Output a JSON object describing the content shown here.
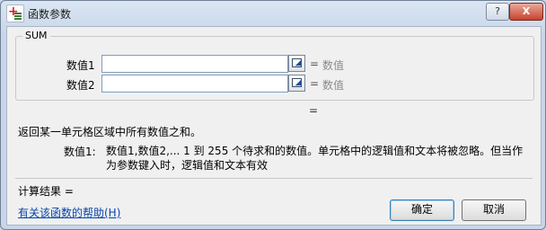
{
  "window": {
    "title": "函数参数",
    "help_glyph": "?",
    "close_glyph": "X"
  },
  "function_group": {
    "name": "SUM",
    "args": [
      {
        "label": "数值1",
        "value": "",
        "result_eq": "=",
        "result": "数值"
      },
      {
        "label": "数值2",
        "value": "",
        "result_eq": "=",
        "result": "数值"
      }
    ],
    "overall_eq": "="
  },
  "description": "返回某一单元格区域中所有数值之和。",
  "param_help": {
    "name": "数值1:",
    "text": "数值1,数值2,... 1 到 255 个待求和的数值。单元格中的逻辑值和文本将被忽略。但当作为参数键入时，逻辑值和文本有效"
  },
  "result": {
    "label": "计算结果 ="
  },
  "help_link": "有关该函数的帮助(H)",
  "buttons": {
    "ok": "确定",
    "cancel": "取消"
  },
  "icons": {
    "app": "insert-function-icon",
    "collapse": "collapse-dialog-icon"
  }
}
